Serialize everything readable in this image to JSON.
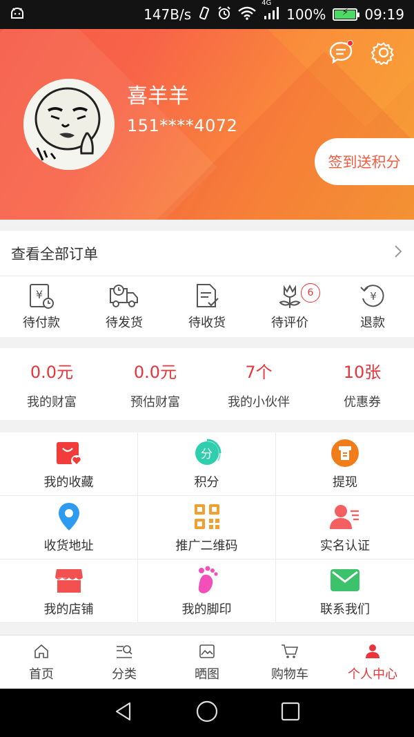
{
  "status_bar": {
    "speed": "147B/s",
    "network": "4G",
    "battery": "100%",
    "battery_level": 1.0,
    "time": "09:19",
    "icons": [
      "android-icon",
      "vibrate-icon",
      "alarm-icon",
      "wifi-icon",
      "signal-icon",
      "battery-icon"
    ]
  },
  "profile": {
    "name": "喜羊羊",
    "phone": "151****4072",
    "checkin_label": "签到送积分"
  },
  "orders": {
    "all_label": "查看全部订单",
    "statuses": [
      {
        "label": "待付款",
        "icon": "wallet-yen-icon"
      },
      {
        "label": "待发货",
        "icon": "truck-icon"
      },
      {
        "label": "待收货",
        "icon": "document-check-icon"
      },
      {
        "label": "待评价",
        "icon": "flower-icon",
        "badge": "6"
      },
      {
        "label": "退款",
        "icon": "refund-yen-icon"
      }
    ]
  },
  "wealth": [
    {
      "value": "0.0元",
      "label": "我的财富"
    },
    {
      "value": "0.0元",
      "label": "预估财富"
    },
    {
      "value": "7个",
      "label": "我的小伙伴"
    },
    {
      "value": "10张",
      "label": "优惠券"
    }
  ],
  "grid": [
    {
      "label": "我的收藏",
      "icon": "favorite-bag-icon"
    },
    {
      "label": "积分",
      "icon": "points-icon",
      "icon_text": "分"
    },
    {
      "label": "提现",
      "icon": "withdraw-icon"
    },
    {
      "label": "收货地址",
      "icon": "location-pin-icon"
    },
    {
      "label": "推广二维码",
      "icon": "qr-code-icon"
    },
    {
      "label": "实名认证",
      "icon": "id-verify-icon"
    },
    {
      "label": "我的店铺",
      "icon": "shop-icon"
    },
    {
      "label": "我的脚印",
      "icon": "footprint-icon"
    },
    {
      "label": "联系我们",
      "icon": "mail-icon"
    }
  ],
  "tabs": [
    {
      "label": "首页",
      "icon": "home-icon"
    },
    {
      "label": "分类",
      "icon": "category-search-icon"
    },
    {
      "label": "晒图",
      "icon": "image-icon"
    },
    {
      "label": "购物车",
      "icon": "cart-icon"
    },
    {
      "label": "个人中心",
      "icon": "person-icon",
      "active": true
    }
  ],
  "colors": {
    "accent": "#e8343a",
    "hero_start": "#f55a45",
    "hero_end": "#f6a135"
  }
}
